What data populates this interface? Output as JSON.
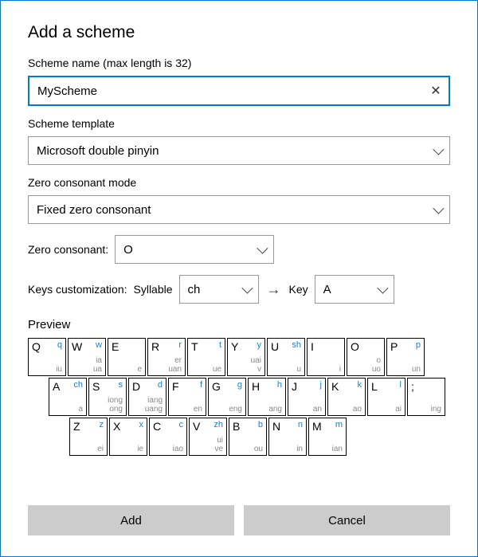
{
  "title": "Add a scheme",
  "schemeName": {
    "label": "Scheme name (max length is 32)",
    "value": "MyScheme",
    "clearGlyph": "✕"
  },
  "schemeTemplate": {
    "label": "Scheme template",
    "value": "Microsoft double pinyin"
  },
  "zeroMode": {
    "label": "Zero consonant mode",
    "value": "Fixed zero consonant"
  },
  "zeroCons": {
    "label": "Zero consonant:",
    "value": "O"
  },
  "keysCustom": {
    "label": "Keys customization:",
    "syllableLabel": "Syllable",
    "syllableValue": "ch",
    "arrow": "→",
    "keyLabel": "Key",
    "keyValue": "A"
  },
  "preview": {
    "label": "Preview"
  },
  "keyboard": {
    "rows": [
      [
        {
          "k": "Q",
          "b": "q",
          "g": "iu"
        },
        {
          "k": "W",
          "b": "w",
          "g": "ia\nua"
        },
        {
          "k": "E",
          "b": "",
          "g": "e"
        },
        {
          "k": "R",
          "b": "r",
          "g": "er\nuan"
        },
        {
          "k": "T",
          "b": "t",
          "g": "ue"
        },
        {
          "k": "Y",
          "b": "y",
          "g": "uai\nv"
        },
        {
          "k": "U",
          "b": "sh",
          "g": "u"
        },
        {
          "k": "I",
          "b": "",
          "g": "i"
        },
        {
          "k": "O",
          "b": "",
          "g": "o\nuo"
        },
        {
          "k": "P",
          "b": "p",
          "g": "un"
        }
      ],
      [
        {
          "k": "A",
          "b": "ch",
          "g": "a"
        },
        {
          "k": "S",
          "b": "s",
          "g": "iong\nong"
        },
        {
          "k": "D",
          "b": "d",
          "g": "iang\nuang"
        },
        {
          "k": "F",
          "b": "f",
          "g": "en"
        },
        {
          "k": "G",
          "b": "g",
          "g": "eng"
        },
        {
          "k": "H",
          "b": "h",
          "g": "ang"
        },
        {
          "k": "J",
          "b": "j",
          "g": "an"
        },
        {
          "k": "K",
          "b": "k",
          "g": "ao"
        },
        {
          "k": "L",
          "b": "l",
          "g": "ai"
        },
        {
          "k": ";",
          "b": "",
          "g": "ing"
        }
      ],
      [
        {
          "k": "Z",
          "b": "z",
          "g": "ei"
        },
        {
          "k": "X",
          "b": "x",
          "g": "ie"
        },
        {
          "k": "C",
          "b": "c",
          "g": "iao"
        },
        {
          "k": "V",
          "b": "zh",
          "g": "ui\nve"
        },
        {
          "k": "B",
          "b": "b",
          "g": "ou"
        },
        {
          "k": "N",
          "b": "n",
          "g": "in"
        },
        {
          "k": "M",
          "b": "m",
          "g": "ian"
        }
      ]
    ]
  },
  "buttons": {
    "add": "Add",
    "cancel": "Cancel"
  }
}
